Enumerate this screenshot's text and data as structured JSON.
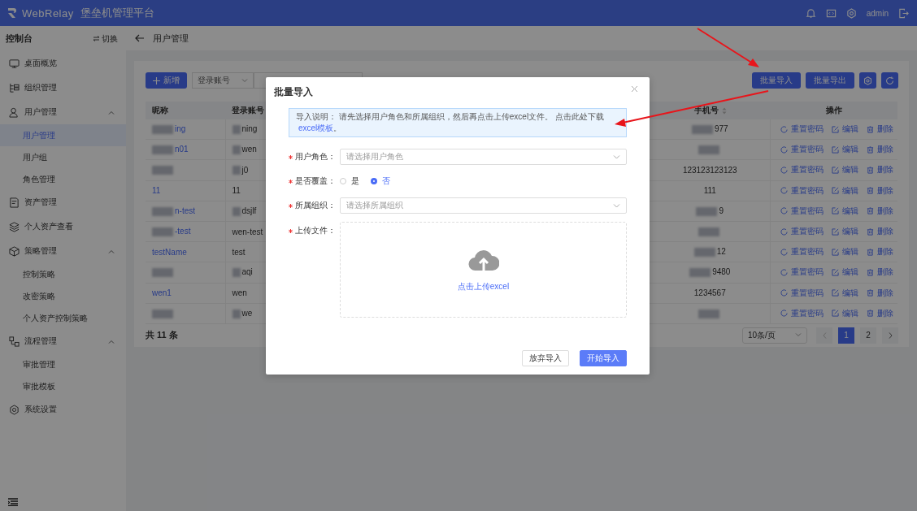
{
  "header": {
    "logo_text": "WebRelay",
    "title": "堡垒机管理平台",
    "user": "admin"
  },
  "sidebar": {
    "title": "控制台",
    "switch_label": "切换",
    "items": [
      {
        "label": "桌面概览"
      },
      {
        "label": "组织管理"
      },
      {
        "label": "用户管理",
        "expanded": true,
        "children": [
          {
            "label": "用户管理",
            "selected": true
          },
          {
            "label": "用户组",
            "selected": false
          },
          {
            "label": "角色管理",
            "selected": false
          }
        ]
      },
      {
        "label": "资产管理"
      },
      {
        "label": "个人资产查看"
      },
      {
        "label": "策略管理",
        "expanded": true,
        "children": [
          {
            "label": "控制策略",
            "selected": false
          },
          {
            "label": "改密策略",
            "selected": false
          },
          {
            "label": "个人资产控制策略",
            "selected": false
          }
        ]
      },
      {
        "label": "流程管理",
        "expanded": true,
        "children": [
          {
            "label": "审批管理",
            "selected": false
          },
          {
            "label": "审批模板",
            "selected": false
          }
        ]
      },
      {
        "label": "系统设置"
      }
    ]
  },
  "breadcrumb": {
    "title": "用户管理"
  },
  "toolbar": {
    "add_button": "新增",
    "filter_select": "登录账号",
    "right_buttons": [
      "批量导入",
      "批量导出"
    ]
  },
  "table": {
    "columns": [
      {
        "label": "昵称"
      },
      {
        "label": "登录账号"
      },
      {
        "label": "手机号",
        "sortable": true
      },
      {
        "label": "操作"
      }
    ],
    "rows": [
      {
        "nickname": {
          "text": "ing",
          "blurred": true
        },
        "login": {
          "text": "ning",
          "blurred": true
        },
        "phone": {
          "text": "977",
          "blurred": true
        },
        "actions": [
          "重置密码",
          "编辑",
          "删除"
        ]
      },
      {
        "nickname": {
          "text": "n01",
          "blurred": true
        },
        "login": {
          "text": "wen",
          "blurred": true
        },
        "phone": {
          "blurred": true
        },
        "actions": [
          "重置密码",
          "编辑",
          "删除"
        ]
      },
      {
        "nickname": {
          "blurred": true
        },
        "login": {
          "text": "j0",
          "blurred": true
        },
        "phone": {
          "text": "123123123123",
          "blurred": false
        },
        "actions": [
          "重置密码",
          "编辑",
          "删除"
        ]
      },
      {
        "nickname": {
          "text": "11",
          "blurred": false
        },
        "login": {
          "text": "11",
          "blurred": false
        },
        "phone": {
          "text": "111",
          "blurred": false
        },
        "actions": [
          "重置密码",
          "编辑",
          "删除"
        ]
      },
      {
        "nickname": {
          "text": "n-test",
          "blurred": true
        },
        "login": {
          "text": "dsjlf",
          "blurred": true
        },
        "phone": {
          "text": "9",
          "blurred": true
        },
        "actions": [
          "重置密码",
          "编辑",
          "删除"
        ]
      },
      {
        "nickname": {
          "text": "-test",
          "blurred": true
        },
        "login": {
          "text": "wen-test",
          "blurred": false
        },
        "phone": {
          "blurred": true
        },
        "actions": [
          "重置密码",
          "编辑",
          "删除"
        ]
      },
      {
        "nickname": {
          "text": "testName",
          "blurred": false
        },
        "login": {
          "text": "test",
          "blurred": false
        },
        "phone": {
          "text": "12",
          "blurred": true
        },
        "actions": [
          "重置密码",
          "编辑",
          "删除"
        ]
      },
      {
        "nickname": {
          "blurred": true
        },
        "login": {
          "text": "aqi",
          "blurred": true
        },
        "phone": {
          "text": "9480",
          "blurred": true
        },
        "actions": [
          "重置密码",
          "编辑",
          "删除"
        ]
      },
      {
        "nickname": {
          "text": "wen1",
          "blurred": false
        },
        "login": {
          "text": "wen",
          "blurred": false
        },
        "phone": {
          "text": "1234567",
          "blurred": false
        },
        "actions": [
          "重置密码",
          "编辑",
          "删除"
        ]
      },
      {
        "nickname": {
          "blurred": true
        },
        "login": {
          "text": "we",
          "blurred": true
        },
        "phone": {
          "blurred": true
        },
        "actions": [
          "重置密码",
          "编辑",
          "删除"
        ]
      }
    ]
  },
  "footer": {
    "total": "共 11 条",
    "page_size": "10条/页",
    "pages": [
      {
        "label": "1",
        "selected": true
      },
      {
        "label": "2",
        "selected": false
      }
    ]
  },
  "modal": {
    "title": "批量导入",
    "notice": {
      "label": "导入说明：",
      "text": "请先选择用户角色和所属组织，然后再点击上传excel文件。 点击此处下载",
      "link": "excel模板",
      "end": "。"
    },
    "fields": [
      {
        "kind": "select",
        "label": "用户角色：",
        "required": true,
        "placeholder": "请选择用户角色"
      },
      {
        "kind": "radio",
        "label": "是否覆盖：",
        "required": true,
        "options": [
          {
            "label": "是",
            "selected": false
          },
          {
            "label": "否",
            "selected": true
          }
        ]
      },
      {
        "kind": "select",
        "label": "所属组织：",
        "required": true,
        "placeholder": "请选择所属组织"
      },
      {
        "kind": "upload",
        "label": "上传文件：",
        "required": true,
        "hint": "点击上传excel"
      }
    ],
    "buttons": [
      {
        "label": "放弃导入",
        "primary": false
      },
      {
        "label": "开始导入",
        "primary": true
      }
    ]
  }
}
